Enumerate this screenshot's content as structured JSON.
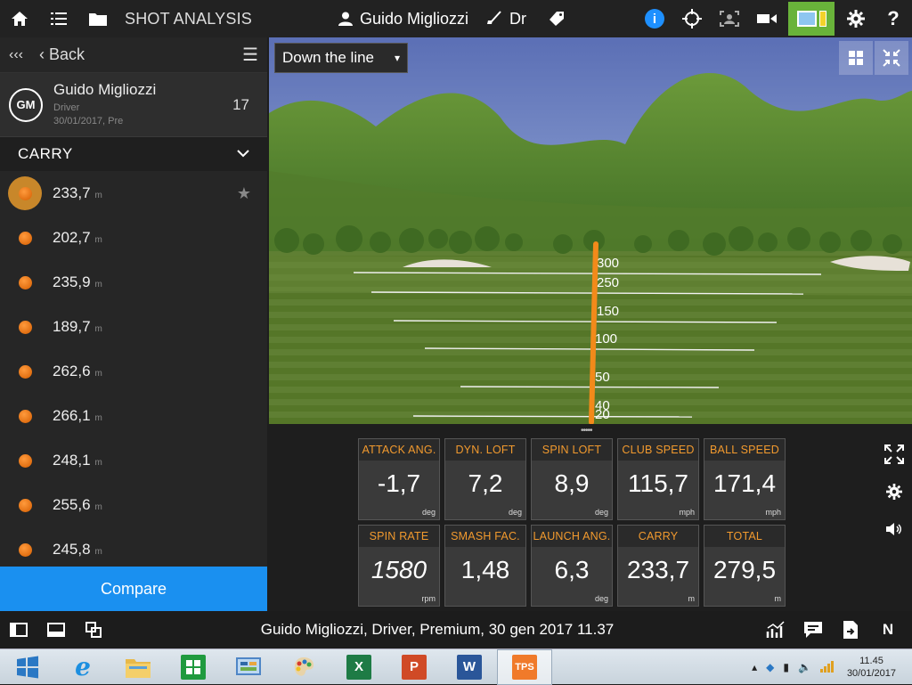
{
  "header": {
    "title": "SHOT ANALYSIS",
    "player_name": "Guido Migliozzi",
    "club": "Dr"
  },
  "sidebar": {
    "back_label": "Back",
    "player": {
      "initials": "GM",
      "name": "Guido Migliozzi",
      "club": "Driver",
      "date": "30/01/2017, Pre",
      "shot_count": "17"
    },
    "metric_label": "CARRY",
    "unit": "m",
    "shots": [
      {
        "value": "233,7",
        "selected": true
      },
      {
        "value": "202,7"
      },
      {
        "value": "235,9"
      },
      {
        "value": "189,7"
      },
      {
        "value": "262,6"
      },
      {
        "value": "266,1"
      },
      {
        "value": "248,1"
      },
      {
        "value": "255,6"
      },
      {
        "value": "245,8"
      }
    ],
    "compare_label": "Compare"
  },
  "viewport": {
    "view_select": "Down the line",
    "distance_markers": [
      "300",
      "250",
      "150",
      "100",
      "50",
      "40",
      "20"
    ]
  },
  "metrics": [
    {
      "label": "ATTACK ANG.",
      "value": "-1,7",
      "unit": "deg"
    },
    {
      "label": "DYN. LOFT",
      "value": "7,2",
      "unit": "deg"
    },
    {
      "label": "SPIN LOFT",
      "value": "8,9",
      "unit": "deg"
    },
    {
      "label": "CLUB SPEED",
      "value": "115,7",
      "unit": "mph"
    },
    {
      "label": "BALL SPEED",
      "value": "171,4",
      "unit": "mph"
    },
    {
      "label": "SPIN RATE",
      "value": "1580",
      "unit": "rpm"
    },
    {
      "label": "SMASH FAC.",
      "value": "1,48",
      "unit": ""
    },
    {
      "label": "LAUNCH ANG.",
      "value": "6,3",
      "unit": "deg"
    },
    {
      "label": "CARRY",
      "value": "233,7",
      "unit": "m"
    },
    {
      "label": "TOTAL",
      "value": "279,5",
      "unit": "m"
    }
  ],
  "status": {
    "caption": "Guido Migliozzi, Driver, Premium, 30 gen 2017 11.37",
    "n_label": "N"
  },
  "taskbar": {
    "tps_label": "TPS",
    "time": "11.45",
    "date": "30/01/2017"
  },
  "colors": {
    "accent_orange": "#f29a2e",
    "compare_blue": "#1a90f0",
    "battery_green": "#69b33a",
    "info_blue": "#1e90ff"
  }
}
